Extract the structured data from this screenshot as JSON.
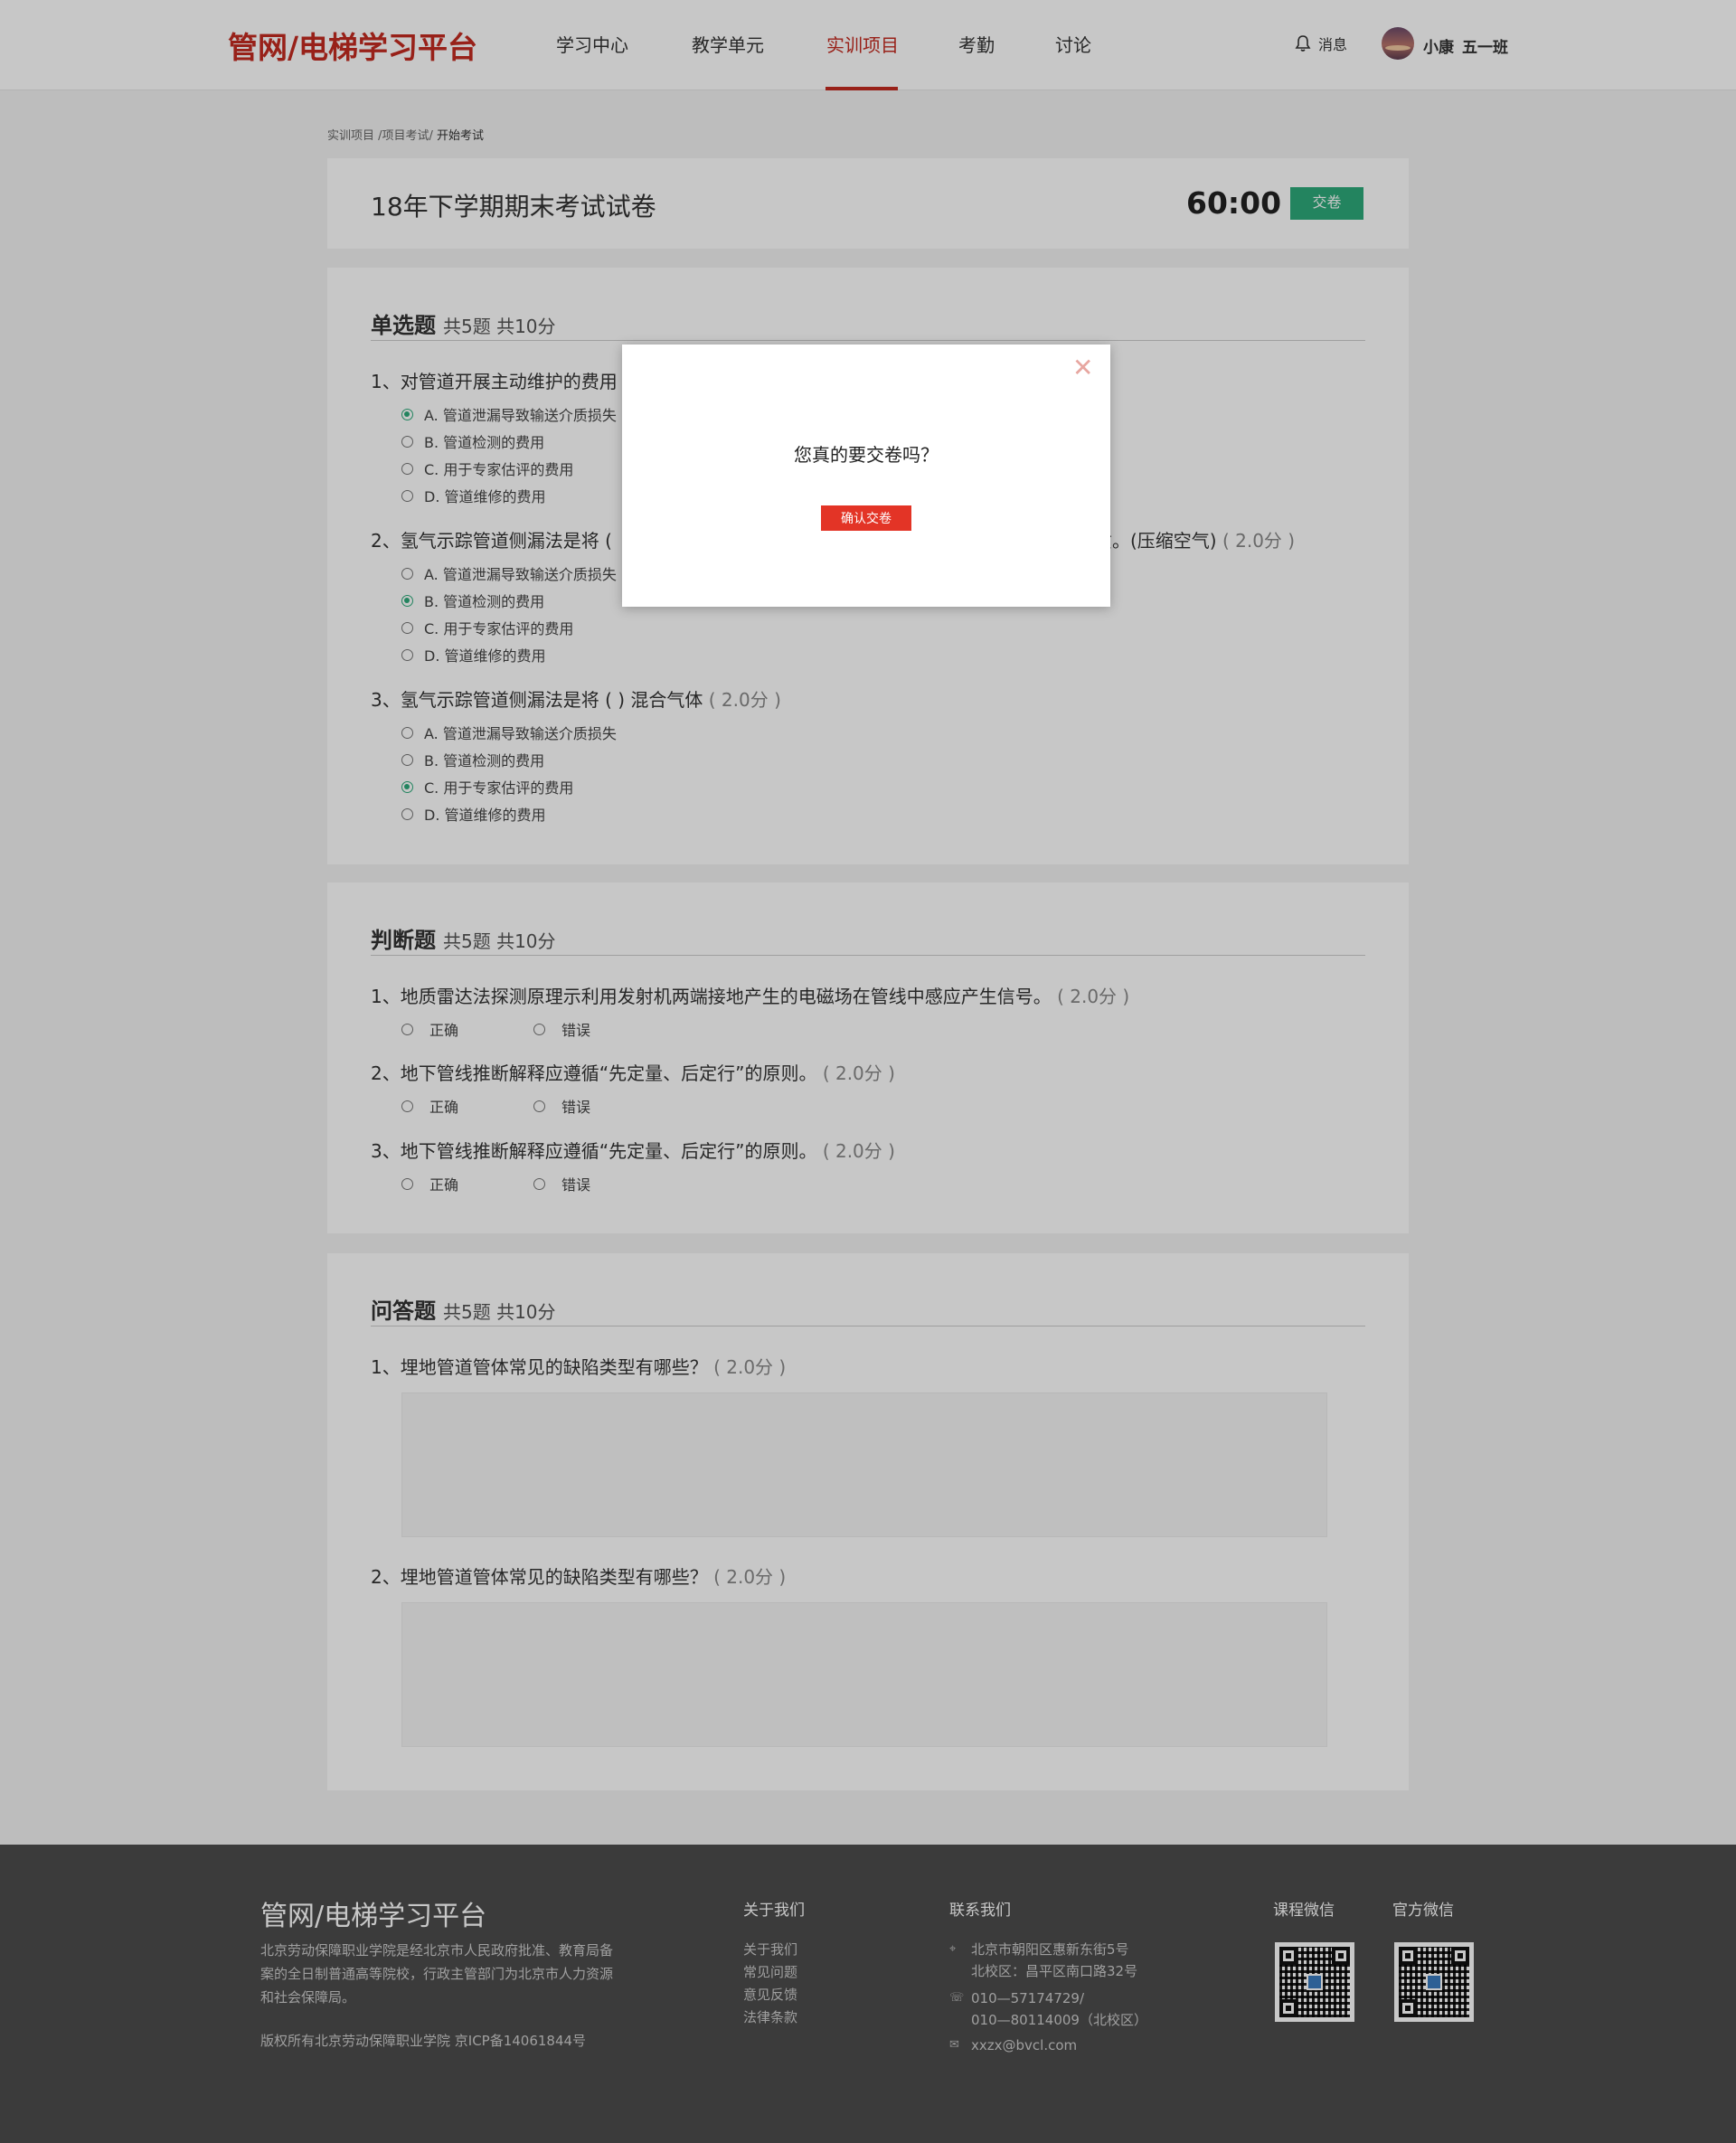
{
  "header": {
    "logo": "管网/电梯学习平台",
    "nav": [
      "学习中心",
      "教学单元",
      "实训项目",
      "考勤",
      "讨论"
    ],
    "active_nav": "实训项目",
    "messages_label": "消息",
    "user_name": "小康",
    "user_class": "五一班"
  },
  "breadcrumb": {
    "part1": "实训项目 /",
    "part2": "项目考试/",
    "current": " 开始考试"
  },
  "exam": {
    "title": "18年下学期期末考试试卷",
    "timer": "60:00",
    "submit_label": "交卷"
  },
  "single_choice": {
    "title": "单选题",
    "meta": "共5题  共10分",
    "questions": [
      {
        "text": "1、对管道开展主动维护的费用",
        "points": "",
        "options": [
          "A. 管道泄漏导致输送介质损失",
          "B. 管道检测的费用",
          "C. 用于专家估评的费用",
          "D. 管道维修的费用"
        ],
        "selected": 0
      },
      {
        "text": "2、氢气示踪管道侧漏法是将 (",
        "text_tail": "质。(压缩空气)",
        "points": "( 2.0分 )",
        "options": [
          "A. 管道泄漏导致输送介质损失",
          "B. 管道检测的费用",
          "C. 用于专家估评的费用",
          "D. 管道维修的费用"
        ],
        "selected": 1
      },
      {
        "text": "3、氢气示踪管道侧漏法是将 (        ) 混合气体",
        "points": "( 2.0分 )",
        "options": [
          "A. 管道泄漏导致输送介质损失",
          "B. 管道检测的费用",
          "C. 用于专家估评的费用",
          "D. 管道维修的费用"
        ],
        "selected": 2
      }
    ]
  },
  "true_false": {
    "title": "判断题",
    "meta": "共5题  共10分",
    "true_label": "正确",
    "false_label": "错误",
    "questions": [
      {
        "text": "1、地质雷达法探测原理示利用发射机两端接地产生的电磁场在管线中感应产生信号。",
        "points": "( 2.0分 )"
      },
      {
        "text": "2、地下管线推断解释应遵循“先定量、后定行”的原则。",
        "points": "( 2.0分 )"
      },
      {
        "text": "3、地下管线推断解释应遵循“先定量、后定行”的原则。",
        "points": "( 2.0分 )"
      }
    ]
  },
  "essay": {
    "title": "问答题",
    "meta": "共5题  共10分",
    "questions": [
      {
        "text": "1、埋地管道管体常见的缺陷类型有哪些？",
        "points": "( 2.0分 )"
      },
      {
        "text": "2、埋地管道管体常见的缺陷类型有哪些？",
        "points": "( 2.0分 )"
      }
    ]
  },
  "modal": {
    "message": "您真的要交卷吗？",
    "confirm_label": "确认交卷",
    "close_icon": "close-icon"
  },
  "footer": {
    "logo": "管网/电梯学习平台",
    "description": "北京劳动保障职业学院是经北京市人民政府批准、教育局备案的全日制普通高等院校，行政主管部门为北京市人力资源和社会保障局。",
    "copyright": "版权所有北京劳动保障职业学院    京ICP备14061844号",
    "about_title": "关于我们",
    "about_links": [
      "关于我们",
      "常见问题",
      "意见反馈",
      "法律条款"
    ],
    "contact_title": "联系我们",
    "address1": "北京市朝阳区惠新东街5号",
    "address2": "北校区：昌平区南口路32号",
    "phone1": "010—57174729/",
    "phone2": "010—80114009（北校区）",
    "email": "xxzx@bvcl.com",
    "wechat_course": "课程微信",
    "wechat_official": "官方微信"
  },
  "colors": {
    "brand_red": "#c32b20",
    "accent_green": "#2daa7a",
    "confirm_red": "#e33426",
    "footer_bg": "#4c4c4c"
  }
}
